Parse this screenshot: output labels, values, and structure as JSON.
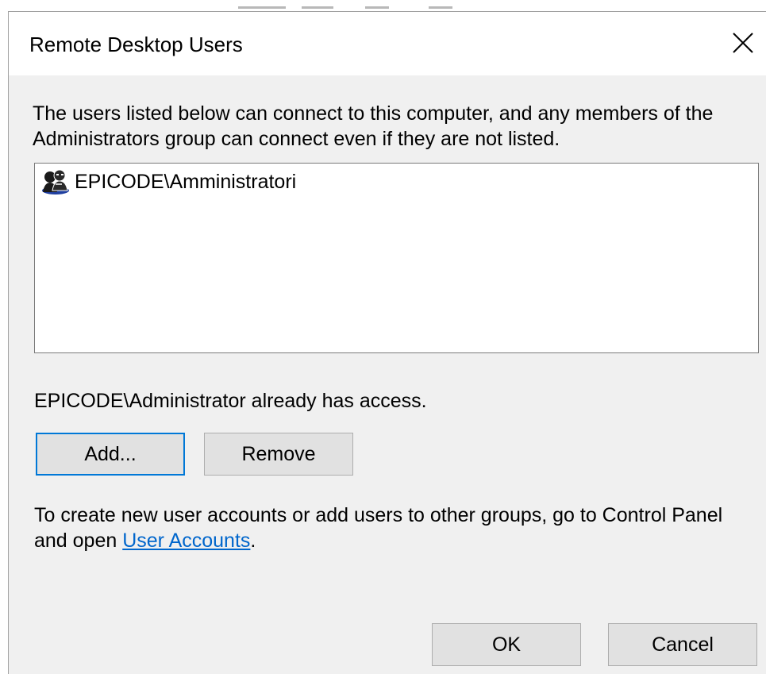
{
  "dialog": {
    "title": "Remote Desktop Users",
    "description": "The users listed below can connect to this computer, and any members of the Administrators group can connect even if they are not listed.",
    "users": [
      {
        "name": "EPICODE\\Amministratori",
        "icon": "user-group-icon"
      }
    ],
    "access_note": "EPICODE\\Administrator already has access.",
    "buttons": {
      "add": "Add...",
      "remove": "Remove",
      "ok": "OK",
      "cancel": "Cancel"
    },
    "info": {
      "before": "To create new user accounts or add users to other groups, go to Control Panel and open ",
      "link": "User Accounts",
      "after": "."
    },
    "close_icon": "close-icon",
    "colors": {
      "accent": "#0078d7",
      "link": "#0066cc",
      "face": "#f0f0f0"
    }
  }
}
